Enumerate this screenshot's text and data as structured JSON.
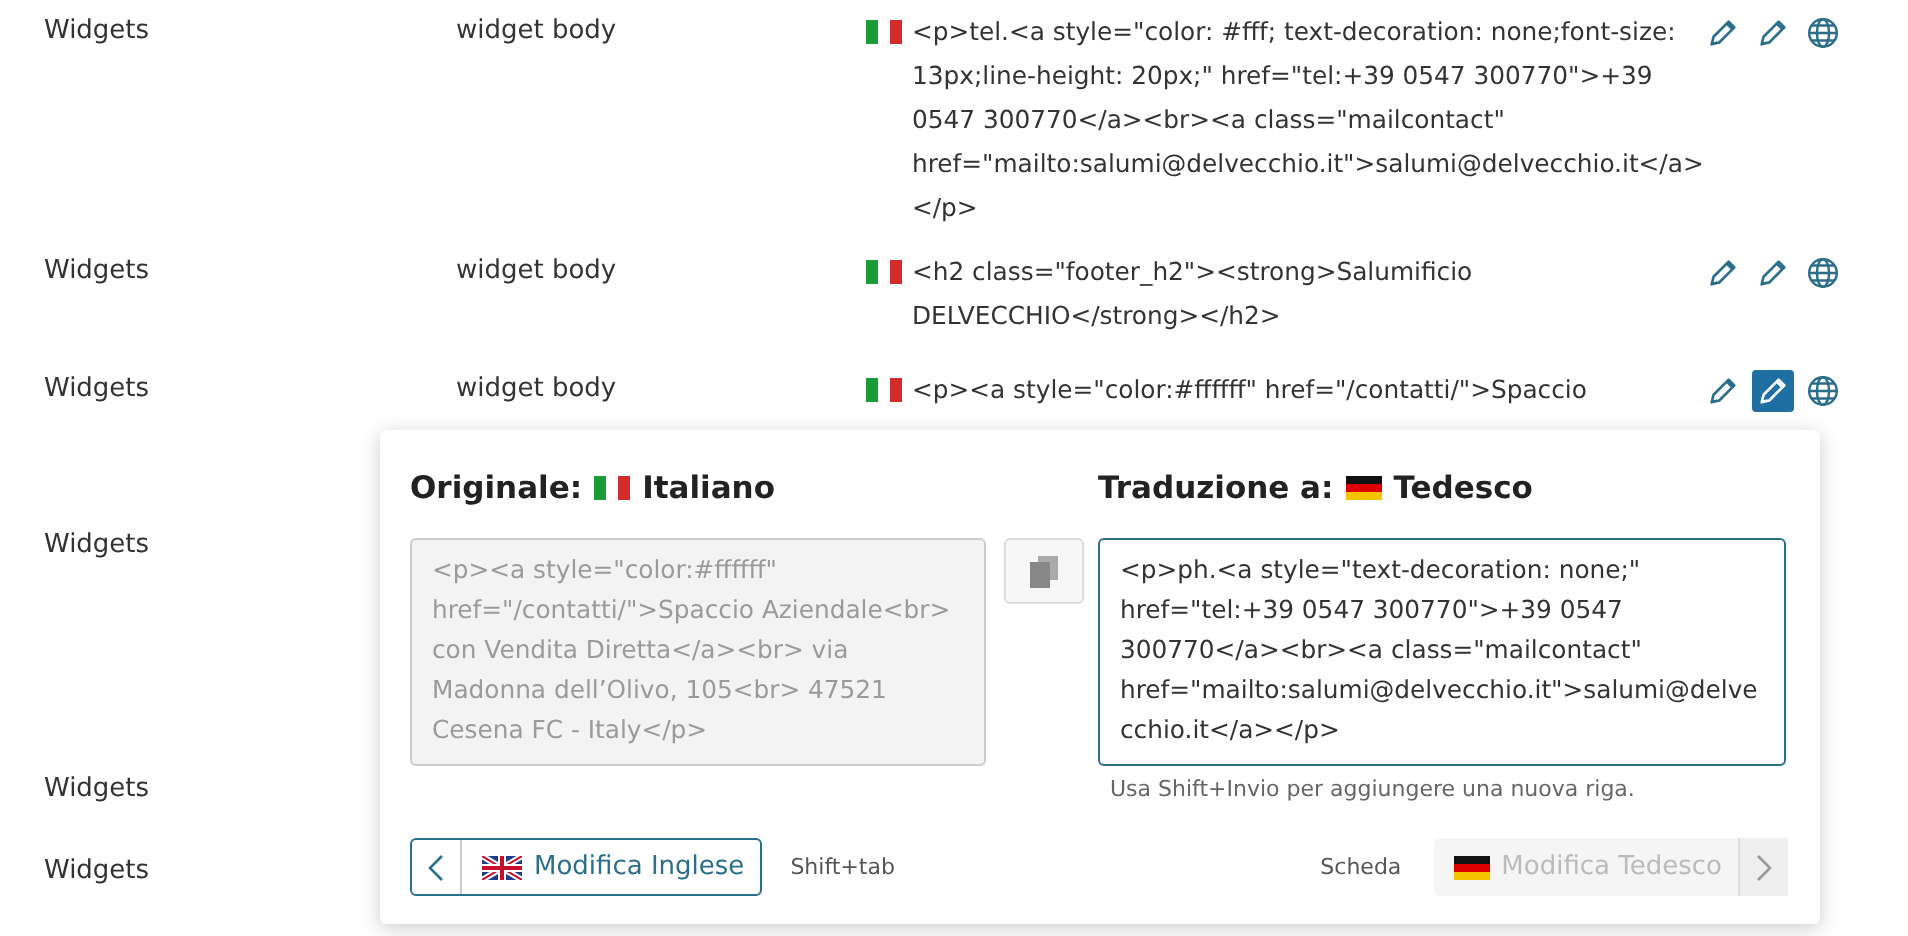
{
  "rows": [
    {
      "section": "Widgets",
      "field": "widget body",
      "content": "<p>tel.<a style=\"color: #fff; text-decoration: none;font-size: 13px;line-height: 20px;\" href=\"tel:+39 0547 300770\">+39 0547 300770</a><br><a class=\"mailcontact\" href=\"mailto:salumi@delvecchio.it\">salumi@delvecchio.it</a> </p>",
      "editing": false
    },
    {
      "section": "Widgets",
      "field": "widget body",
      "content": "<h2 class=\"footer_h2\"><strong>Salumificio DELVECCHIO</strong></h2>",
      "editing": false
    },
    {
      "section": "Widgets",
      "field": "widget body",
      "content": "<p><a style=\"color:#ffffff\" href=\"/contatti/\">Spaccio",
      "editing": true
    },
    {
      "section": "Widgets"
    },
    {
      "section": "Widgets"
    },
    {
      "section": "Widgets"
    }
  ],
  "editor": {
    "original_heading": "Originale:",
    "original_language": "Italiano",
    "translation_heading": "Traduzione a:",
    "translation_language": "Tedesco",
    "original_text": "<p><a style=\"color:#ffffff\" href=\"/contatti/\">Spaccio Aziendale<br> con Vendita Diretta</a><br> via Madonna dell’Olivo, 105<br> 47521 Cesena FC - Italy</p>",
    "translation_text": "<p>ph.<a style=\"text-decoration: none;\" href=\"tel:+39 0547 300770\">+39 0547 300770</a><br><a class=\"mailcontact\" href=\"mailto:salumi@delvecchio.it\">salumi@delvecchio.it</a></p>",
    "hint": "Usa Shift+Invio per aggiungere una nuova riga.",
    "previous_button": "Modifica Inglese",
    "previous_shortcut": "Shift+tab",
    "next_label": "Scheda",
    "next_button": {
      "label": "Modifica Tedesco",
      "disabled": true
    }
  }
}
